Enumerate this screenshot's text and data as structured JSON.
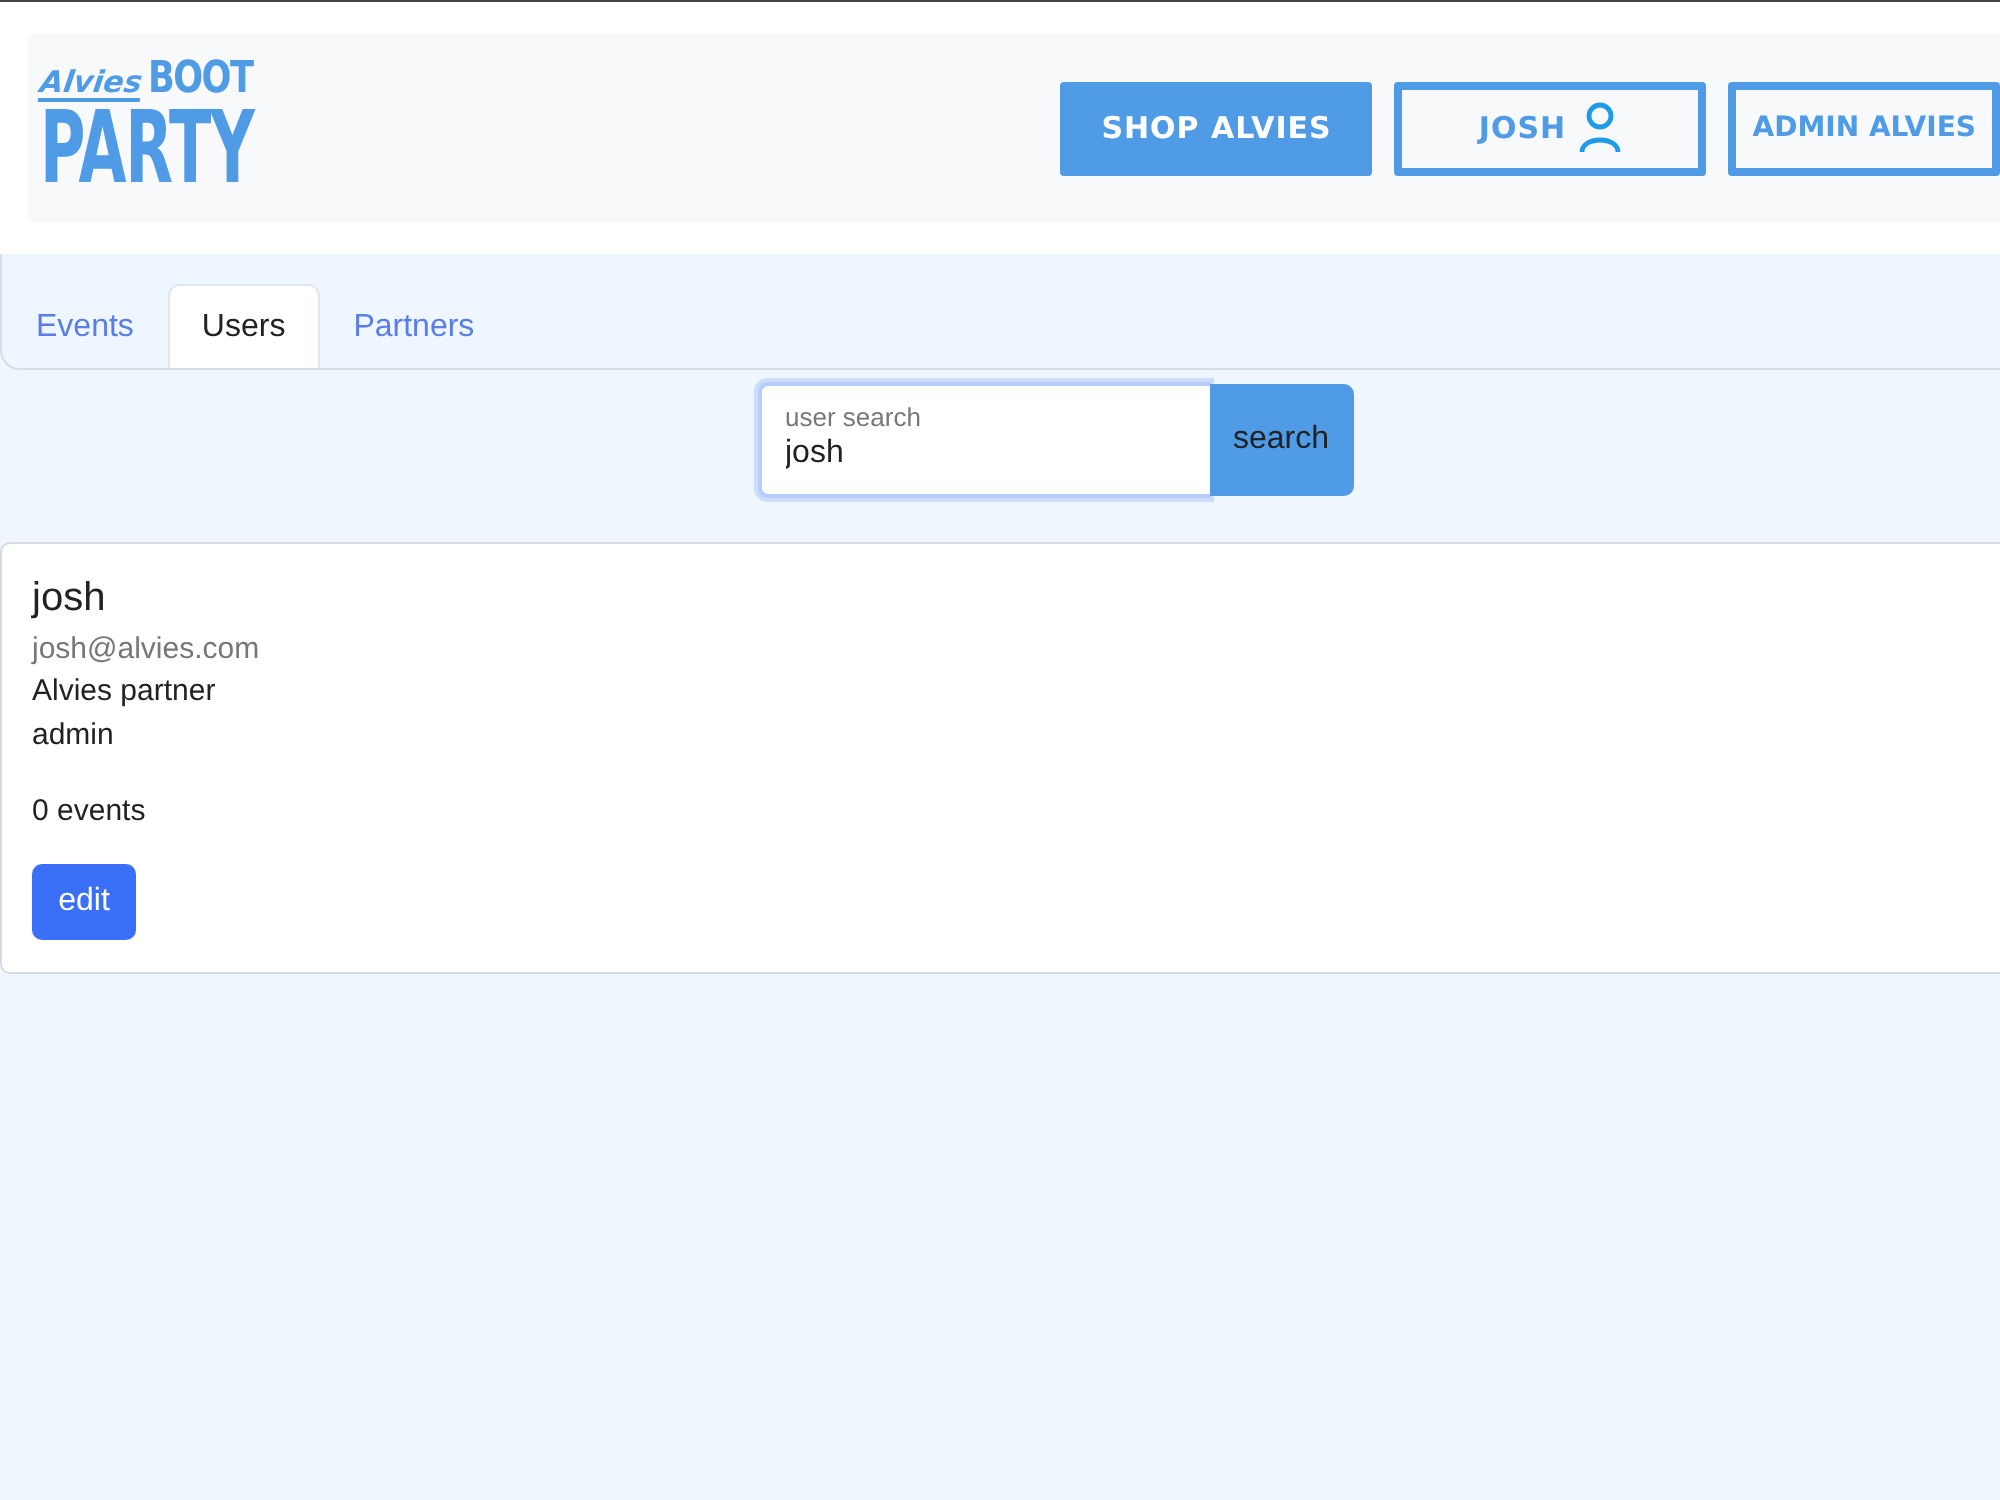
{
  "logo": {
    "script": "Alvies",
    "top": "BOOT",
    "bottom": "PARTY"
  },
  "nav_buttons": [
    {
      "label": "SHOP ALVIES",
      "kind": "filled"
    },
    {
      "label": "JOSH",
      "kind": "user"
    },
    {
      "label": "ADMIN ALVIES",
      "kind": "outline"
    }
  ],
  "tabs": [
    {
      "label": "Events",
      "selected": false
    },
    {
      "label": "Users",
      "selected": true
    },
    {
      "label": "Partners",
      "selected": false
    }
  ],
  "search": {
    "label": "user search",
    "value": "josh",
    "button": "search"
  },
  "users": [
    {
      "name": "josh",
      "email": "josh@alvies.com",
      "lines": [
        "Alvies partner",
        "admin"
      ],
      "events": "0 events",
      "button": "edit"
    }
  ]
}
